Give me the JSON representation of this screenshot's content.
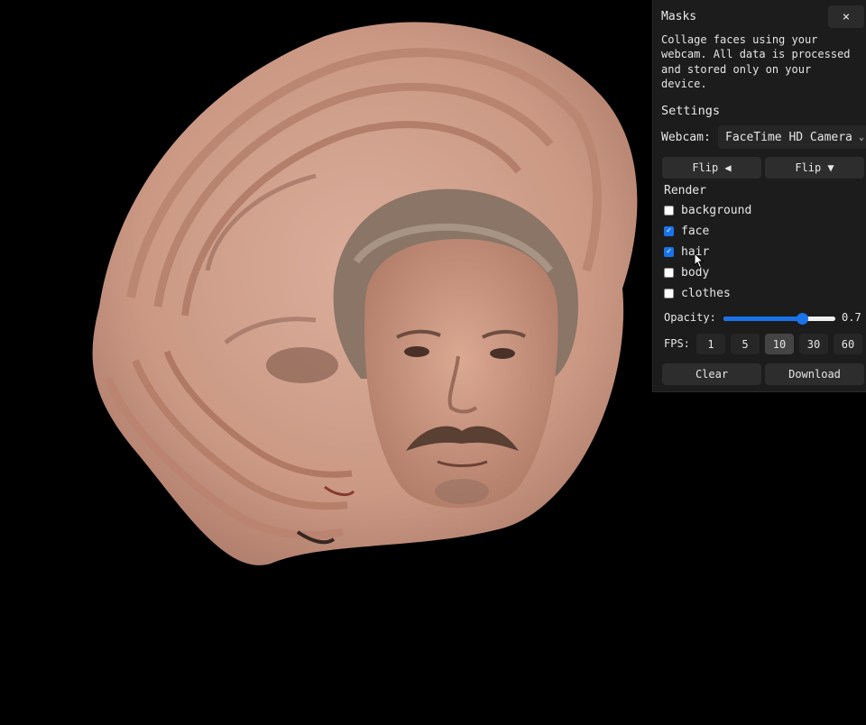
{
  "panel": {
    "title": "Masks",
    "close_label": "×",
    "description": "Collage faces using your webcam. All data is processed and stored only on your device.",
    "settings_title": "Settings",
    "webcam": {
      "label": "Webcam:",
      "value": "FaceTime HD Camera"
    },
    "flip_horizontal_label": "Flip ◀",
    "flip_vertical_label": "Flip ▼",
    "render": {
      "title": "Render",
      "options": [
        {
          "label": "background",
          "checked": false
        },
        {
          "label": "face",
          "checked": true
        },
        {
          "label": "hair",
          "checked": true
        },
        {
          "label": "body",
          "checked": false
        },
        {
          "label": "clothes",
          "checked": false
        }
      ]
    },
    "opacity": {
      "label": "Opacity:",
      "value": 0.7,
      "value_text": "0.7"
    },
    "fps": {
      "label": "FPS:",
      "options": [
        "1",
        "5",
        "10",
        "30",
        "60"
      ],
      "selected": "10"
    },
    "clear_label": "Clear",
    "download_label": "Download"
  },
  "colors": {
    "accent": "#1a73e8",
    "panel_bg": "#1c1c1c",
    "button_bg": "#2d2d2d",
    "background": "#000000",
    "skin": "#d8a58f"
  }
}
